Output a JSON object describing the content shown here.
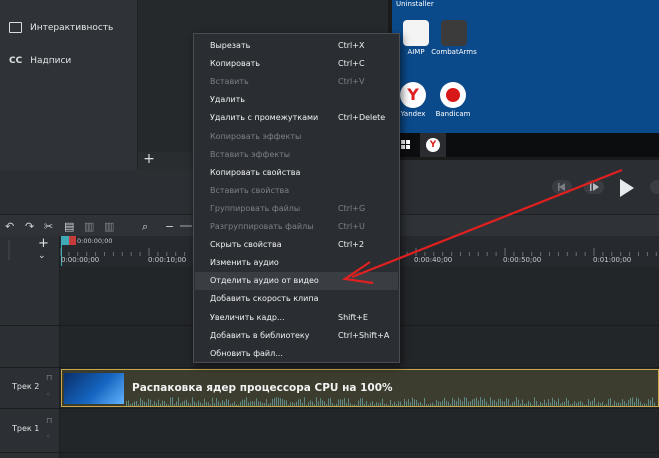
{
  "tools": {
    "interactivity_label": "Интерактивность",
    "captions_label": "Надписи",
    "captions_icon_text": "CC"
  },
  "media_bin": {
    "add_button": "+"
  },
  "desktop": {
    "uninstaller_label": "Uninstaller",
    "icons": [
      {
        "label": "AIMP",
        "color": "#f2f2f2"
      },
      {
        "label": "CombatArms",
        "color": "#3a3a3a"
      },
      {
        "label": "Yandex",
        "color": "#ffffff"
      },
      {
        "label": "Bandicam",
        "color": "#ffffff"
      }
    ]
  },
  "timeline": {
    "playhead_time": "0:00:00;00",
    "ticks": [
      "0:00:00;00",
      "0:00:10;00",
      "0:00:40;00",
      "0:00:50;00",
      "0:01:00;00"
    ],
    "tracks": [
      {
        "label": "Трек 2"
      },
      {
        "label": "Трек 1"
      }
    ],
    "clip_title": "Распаковка ядер процессора CPU на 100%"
  },
  "context_menu": {
    "items": [
      {
        "label": "Вырезать",
        "shortcut": "Ctrl+X",
        "disabled": false
      },
      {
        "label": "Копировать",
        "shortcut": "Ctrl+C",
        "disabled": false
      },
      {
        "label": "Вставить",
        "shortcut": "Ctrl+V",
        "disabled": true
      },
      {
        "label": "Удалить",
        "shortcut": "",
        "disabled": false
      },
      {
        "label": "Удалить с промежутками",
        "shortcut": "Ctrl+Delete",
        "disabled": false
      },
      {
        "label": "Копировать эффекты",
        "shortcut": "",
        "disabled": true
      },
      {
        "label": "Вставить эффекты",
        "shortcut": "",
        "disabled": true
      },
      {
        "label": "Копировать свойства",
        "shortcut": "",
        "disabled": false
      },
      {
        "label": "Вставить свойства",
        "shortcut": "",
        "disabled": true
      },
      {
        "label": "Группировать файлы",
        "shortcut": "Ctrl+G",
        "disabled": true
      },
      {
        "label": "Разгруппировать файлы",
        "shortcut": "Ctrl+U",
        "disabled": true
      },
      {
        "label": "Скрыть свойства",
        "shortcut": "Ctrl+2",
        "disabled": false
      },
      {
        "label": "Изменить аудио",
        "shortcut": "",
        "disabled": false
      },
      {
        "label": "Отделить аудио от видео",
        "shortcut": "",
        "disabled": false,
        "highlighted": true
      },
      {
        "label": "Добавить скорость клипа",
        "shortcut": "",
        "disabled": false
      },
      {
        "label": "Увеличить кадр...",
        "shortcut": "Shift+E",
        "disabled": false
      },
      {
        "label": "Добавить в библиотеку",
        "shortcut": "Ctrl+Shift+A",
        "disabled": false
      },
      {
        "label": "Обновить файл...",
        "shortcut": "",
        "disabled": false
      }
    ]
  },
  "colors": {
    "accent_arrow": "#e02020",
    "clip_border": "#c9a646",
    "menu_bg": "#2a2d31"
  }
}
